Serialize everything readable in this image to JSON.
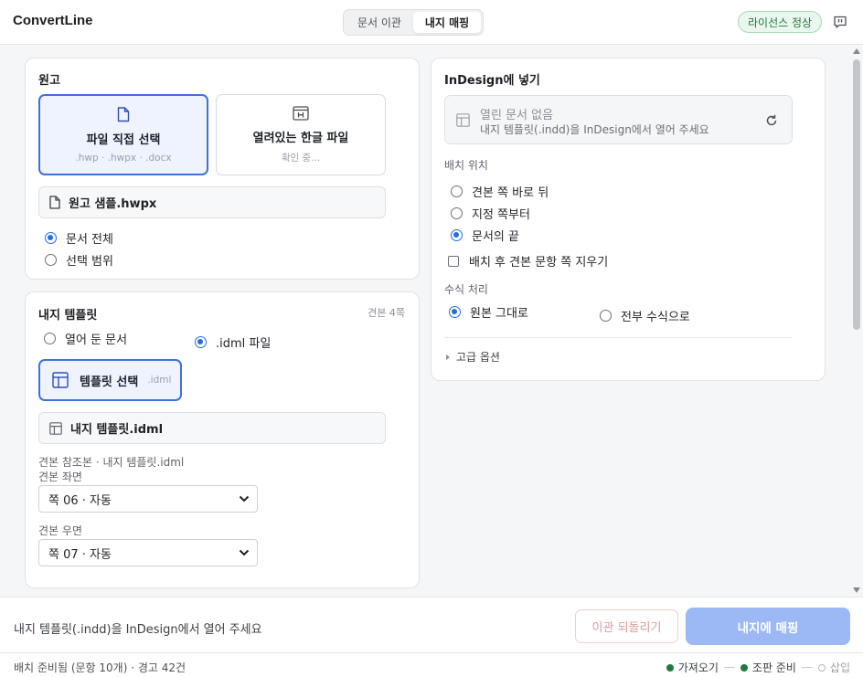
{
  "header": {
    "app_title": "ConvertLine",
    "tabs": [
      {
        "label": "문서 이관",
        "active": false
      },
      {
        "label": "내지 매핑",
        "active": true
      }
    ],
    "license_badge": "라이선스 정상"
  },
  "manuscript": {
    "title": "원고",
    "direct_pick": {
      "label": "파일 직접 선택",
      "sub": ".hwp · .hwpx · .docx"
    },
    "open_hangul": {
      "label": "열려있는 한글 파일",
      "sub": "확인 중..."
    },
    "file_name": "원고 샘플.hwpx",
    "scope_options": [
      {
        "label": "문서 전체",
        "selected": true
      },
      {
        "label": "선택 범위",
        "selected": false
      }
    ]
  },
  "template": {
    "title": "내지 템플릿",
    "page_count": "견본 4쪽",
    "source_options": [
      {
        "label": "열어 둔 문서",
        "selected": false
      },
      {
        "label": ".idml 파일",
        "selected": true
      }
    ],
    "pick_button": {
      "label": "템플릿 선택",
      "ext": ".idml"
    },
    "file_name": "내지 템플릿.idml",
    "ref_line": "견본 참조본 · 내지 템플릿.idml",
    "left_label": "견본 좌면",
    "left_value": "쪽 06 · 자동",
    "right_label": "견본 우면",
    "right_value": "쪽 07 · 자동"
  },
  "indesign": {
    "title": "InDesign에 넣기",
    "doc_status_title": "열린 문서 없음",
    "doc_status_sub": "내지 템플릿(.indd)을 InDesign에서 열어 주세요",
    "placement_label": "배치 위치",
    "placement_options": [
      {
        "label": "견본 쪽 바로 뒤",
        "selected": false
      },
      {
        "label": "지정 쪽부터",
        "selected": false
      },
      {
        "label": "문서의 끝",
        "selected": true
      }
    ],
    "delete_after_label": "배치 후 견본 문항 쪽 지우기",
    "formula_label": "수식 처리",
    "formula_options": [
      {
        "label": "원본 그대로",
        "selected": true
      },
      {
        "label": "전부 수식으로",
        "selected": false
      }
    ],
    "advanced_label": "고급 옵션"
  },
  "footer": {
    "message": "내지 템플릿(.indd)을 InDesign에서 열어 주세요",
    "undo_label": "이관 되돌리기",
    "map_label": "내지에 매핑",
    "status": "배치 준비됨 (문항 10개) · 경고 42건",
    "steps": [
      {
        "label": "가져오기",
        "done": true
      },
      {
        "label": "조판 준비",
        "done": true
      },
      {
        "label": "삽입",
        "done": false
      }
    ]
  },
  "colors": {
    "accent": "#3f6fe0",
    "success": "#1f7a3c",
    "primary_disabled": "#9cb8f5"
  }
}
